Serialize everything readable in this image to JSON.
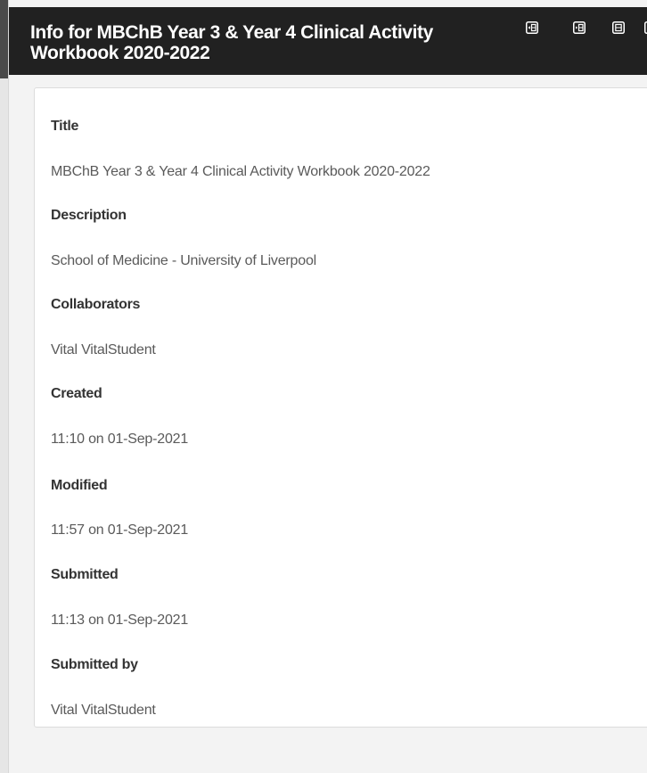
{
  "panel": {
    "title": "Info for MBChB Year 3 & Year 4 Clinical Activity Workbook 2020-2022",
    "actions": [
      {
        "name": "expand-left-icon"
      },
      {
        "name": "collapse-left-icon"
      },
      {
        "name": "maximize-icon"
      },
      {
        "name": "close-icon"
      }
    ]
  },
  "info": {
    "title_label": "Title",
    "title_value": "MBChB Year 3 & Year 4 Clinical Activity Workbook 2020-2022",
    "description_label": "Description",
    "description_value": "School of Medicine - University of Liverpool",
    "collaborators_label": "Collaborators",
    "collaborators_value": "Vital VitalStudent",
    "created_label": "Created",
    "created_value": "11:10 on 01-Sep-2021",
    "modified_label": "Modified",
    "modified_value": "11:57 on 01-Sep-2021",
    "submitted_label": "Submitted",
    "submitted_value": "11:13 on 01-Sep-2021",
    "submitted_by_label": "Submitted by",
    "submitted_by_value": "Vital VitalStudent"
  },
  "colors": {
    "header_bg": "#212121",
    "header_text": "#ffffff",
    "panel_bg": "#f3f3f3",
    "card_bg": "#ffffff",
    "label_text": "#333333",
    "value_text": "#5a5a5a"
  }
}
